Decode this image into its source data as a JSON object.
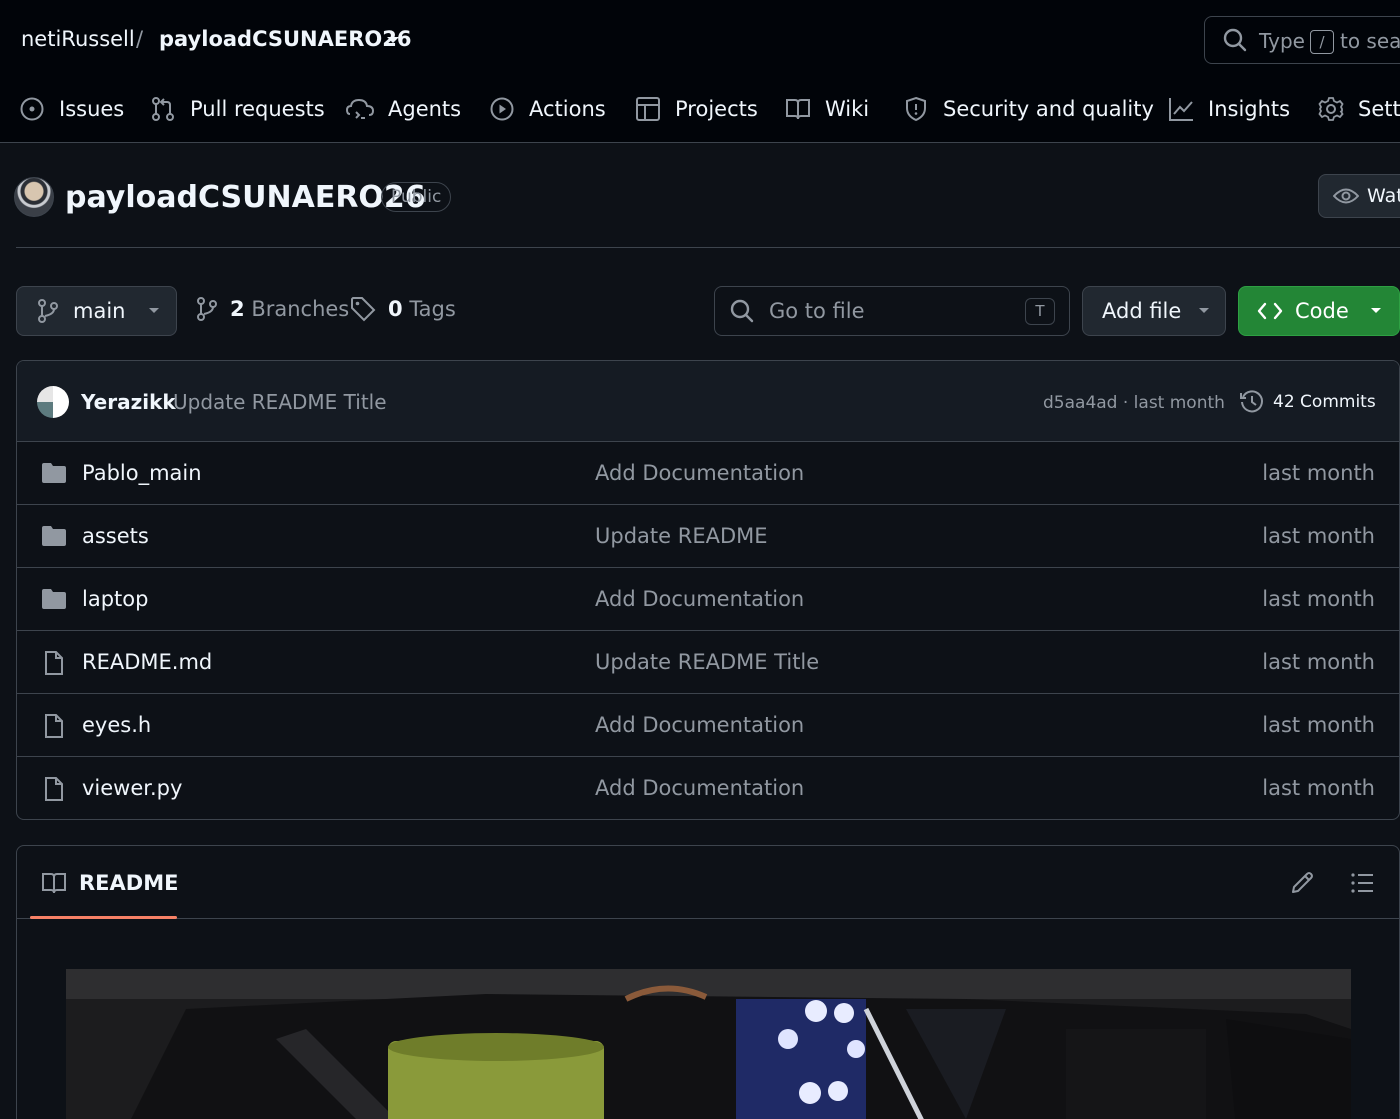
{
  "header": {
    "owner": "netiRussell",
    "separator": "/",
    "repo": "payloadCSUNAERO26",
    "search": {
      "prefix": "Type",
      "key": "/",
      "suffix": "to search"
    }
  },
  "nav": {
    "tabs": [
      {
        "label": "Issues",
        "icon": "issue-opened-icon"
      },
      {
        "label": "Pull requests",
        "icon": "git-pull-request-icon"
      },
      {
        "label": "Agents",
        "icon": "agent-icon"
      },
      {
        "label": "Actions",
        "icon": "play-icon"
      },
      {
        "label": "Projects",
        "icon": "table-icon"
      },
      {
        "label": "Wiki",
        "icon": "book-icon"
      },
      {
        "label": "Security and quality",
        "icon": "shield-icon"
      },
      {
        "label": "Insights",
        "icon": "graph-icon"
      },
      {
        "label": "Settings",
        "icon": "gear-icon"
      }
    ]
  },
  "repo": {
    "title": "payloadCSUNAERO26",
    "visibility": "Public",
    "watch_label": "Watch"
  },
  "toolbar": {
    "branch": "main",
    "branches_count": "2",
    "branches_label": "Branches",
    "tags_count": "0",
    "tags_label": "Tags",
    "goto_placeholder": "Go to file",
    "goto_key": "T",
    "add_file": "Add file",
    "code": "Code"
  },
  "latest_commit": {
    "author": "Yerazikk",
    "message": "Update README Title",
    "hash_time": "d5aa4ad · last month",
    "commits_count": "42",
    "commits_label": "Commits"
  },
  "files": [
    {
      "name": "Pablo_main",
      "type": "folder",
      "commit": "Add Documentation",
      "time": "last month"
    },
    {
      "name": "assets",
      "type": "folder",
      "commit": "Update README",
      "time": "last month"
    },
    {
      "name": "laptop",
      "type": "folder",
      "commit": "Add Documentation",
      "time": "last month"
    },
    {
      "name": "README.md",
      "type": "file",
      "commit": "Update README Title",
      "time": "last month"
    },
    {
      "name": "eyes.h",
      "type": "file",
      "commit": "Add Documentation",
      "time": "last month"
    },
    {
      "name": "viewer.py",
      "type": "file",
      "commit": "Add Documentation",
      "time": "last month"
    }
  ],
  "readme": {
    "tab_label": "README"
  },
  "colors": {
    "background": "#0d1117",
    "header": "#010409",
    "border": "#3d444d",
    "code_button": "#238636",
    "accent_underline": "#f78166",
    "muted_text": "#9198a1"
  }
}
